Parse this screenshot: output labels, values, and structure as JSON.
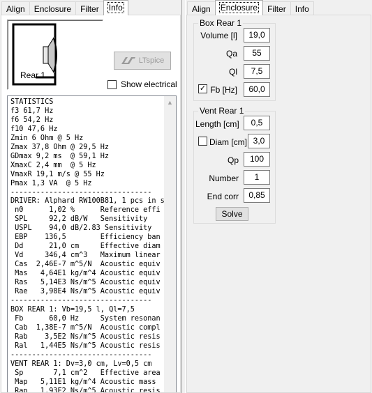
{
  "left_panel": {
    "tabs": [
      {
        "label": "Align"
      },
      {
        "label": "Enclosure"
      },
      {
        "label": "Filter"
      },
      {
        "label": "Info",
        "active": true
      }
    ],
    "preview": {
      "label": "Rear 1"
    },
    "ltspice_button": {
      "label": "LTspice"
    },
    "show_electrical": {
      "label": "Show electrical",
      "checked": false
    },
    "stats_lines": [
      "STATISTICS",
      "f3 61,7 Hz",
      "f6 54,2 Hz",
      "f10 47,6 Hz",
      "Zmin 6 Ohm @ 5 Hz",
      "Zmax 37,8 Ohm @ 29,5 Hz",
      "GDmax 9,2 ms  @ 59,1 Hz",
      "XmaxC 2,4 mm  @ 5 Hz",
      "VmaxR 19,1 m/s @ 55 Hz",
      "Pmax 1,3 VA  @ 5 Hz",
      "---------------------------------",
      "DRIVER: Alphard RW100B81, 1 pcs in s",
      " n0      1,02 %      Reference effi",
      " SPL     92,2 dB/W   Sensitivity",
      " USPL    94,0 dB/2.83 Sensitivity",
      " EBP    136,5        Efficiency ban",
      " Dd      21,0 cm     Effective diam",
      " Vd     346,4 cm^3   Maximum linear",
      " Cas  2,46E-7 m^5/N  Acoustic equiv",
      " Mas   4,64E1 kg/m^4 Acoustic equiv",
      " Ras   5,14E3 Ns/m^5 Acoustic equiv",
      " Rae   3,98E4 Ns/m^5 Acoustic equiv",
      "---------------------------------",
      "BOX REAR 1: Vb=19,5 l, Ql=7,5",
      " Fb      60,0 Hz     System resonan",
      " Cab  1,38E-7 m^5/N  Acoustic compl",
      " Rab    3,5E2 Ns/m^5 Acoustic resis",
      " Ral   1,44E5 Ns/m^5 Acoustic resis",
      "---------------------------------",
      "VENT REAR 1: Dv=3,0 cm, Lv=0,5 cm",
      " Sp       7,1 cm^2   Effective area",
      " Map   5,11E1 kg/m^4 Acoustic mass",
      " Rap   1,93E2 Ns/m^5 Acoustic resis"
    ]
  },
  "right_panel": {
    "tabs": [
      {
        "label": "Align"
      },
      {
        "label": "Enclosure",
        "active": true
      },
      {
        "label": "Filter"
      },
      {
        "label": "Info"
      }
    ],
    "box_group": {
      "title": "Box Rear 1",
      "volume": {
        "label": "Volume [l]",
        "value": "19,0"
      },
      "qa": {
        "label": "Qa",
        "value": "55"
      },
      "ql": {
        "label": "Ql",
        "value": "7,5"
      },
      "fb": {
        "label": "Fb [Hz]",
        "value": "60,0",
        "checked": true
      }
    },
    "vent_group": {
      "title": "Vent Rear 1",
      "length": {
        "label": "Length [cm]",
        "value": "0,5"
      },
      "diam": {
        "label": "Diam [cm]",
        "value": "3,0",
        "checked": false
      },
      "qp": {
        "label": "Qp",
        "value": "100"
      },
      "number": {
        "label": "Number",
        "value": "1"
      },
      "end_corr": {
        "label": "End corr",
        "value": "0,85"
      },
      "solve_label": "Solve"
    }
  },
  "colors": {
    "ltspice_gray": "#9a9a9a",
    "tab_active_bg": "#ffffff"
  }
}
